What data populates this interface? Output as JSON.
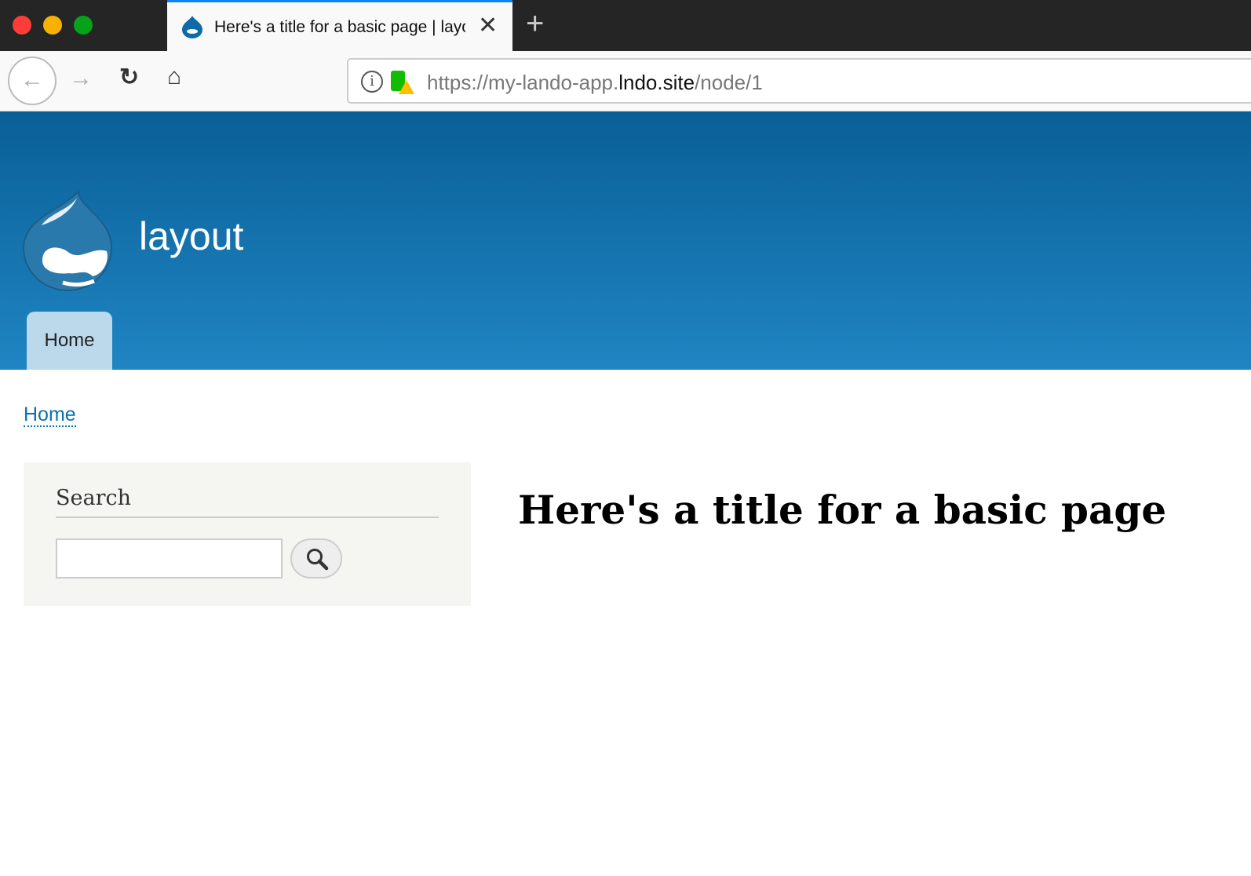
{
  "browser": {
    "tab_title": "Here's a title for a basic page | layout",
    "url_prefix": "https://my-lando-app.",
    "url_domain": "lndo.site",
    "url_path": "/node/1",
    "accent_color": "#0a84ff"
  },
  "site": {
    "name": "layout",
    "nav": [
      {
        "label": "Home"
      }
    ],
    "breadcrumb": [
      {
        "label": "Home"
      }
    ]
  },
  "sidebar": {
    "search_title": "Search",
    "search_value": ""
  },
  "main": {
    "title": "Here's a title for a basic page"
  }
}
